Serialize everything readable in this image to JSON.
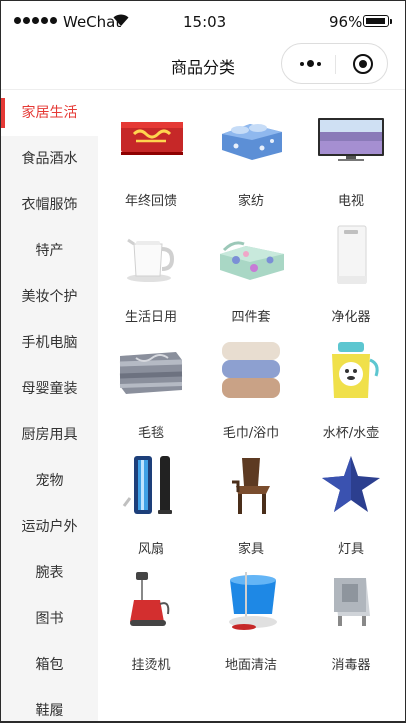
{
  "status_bar": {
    "carrier": "WeChat",
    "time": "15:03",
    "battery": "96%"
  },
  "nav": {
    "title": "商品分类"
  },
  "sidebar": {
    "active_color": "#e53935",
    "items": [
      {
        "label": "家居生活"
      },
      {
        "label": "食品酒水"
      },
      {
        "label": "衣帽服饰"
      },
      {
        "label": "特产"
      },
      {
        "label": "美妆个护"
      },
      {
        "label": "手机电脑"
      },
      {
        "label": "母婴童装"
      },
      {
        "label": "厨房用具"
      },
      {
        "label": "宠物"
      },
      {
        "label": "运动户外"
      },
      {
        "label": "腕表"
      },
      {
        "label": "图书"
      },
      {
        "label": "箱包"
      },
      {
        "label": "鞋履"
      }
    ]
  },
  "grid": {
    "items": [
      {
        "label": "年终回馈",
        "icon": "gift-box-icon"
      },
      {
        "label": "家纺",
        "icon": "bedding-icon"
      },
      {
        "label": "电视",
        "icon": "tv-icon"
      },
      {
        "label": "生活日用",
        "icon": "kettle-icon"
      },
      {
        "label": "四件套",
        "icon": "sheet-set-icon"
      },
      {
        "label": "净化器",
        "icon": "purifier-icon"
      },
      {
        "label": "毛毯",
        "icon": "blanket-icon"
      },
      {
        "label": "毛巾/浴巾",
        "icon": "towel-icon"
      },
      {
        "label": "水杯/水壶",
        "icon": "bottle-icon"
      },
      {
        "label": "风扇",
        "icon": "fan-icon"
      },
      {
        "label": "家具",
        "icon": "chair-icon"
      },
      {
        "label": "灯具",
        "icon": "star-lamp-icon"
      },
      {
        "label": "挂烫机",
        "icon": "steamer-icon"
      },
      {
        "label": "地面清洁",
        "icon": "mop-bucket-icon"
      },
      {
        "label": "消毒器",
        "icon": "sterilizer-icon"
      }
    ]
  }
}
